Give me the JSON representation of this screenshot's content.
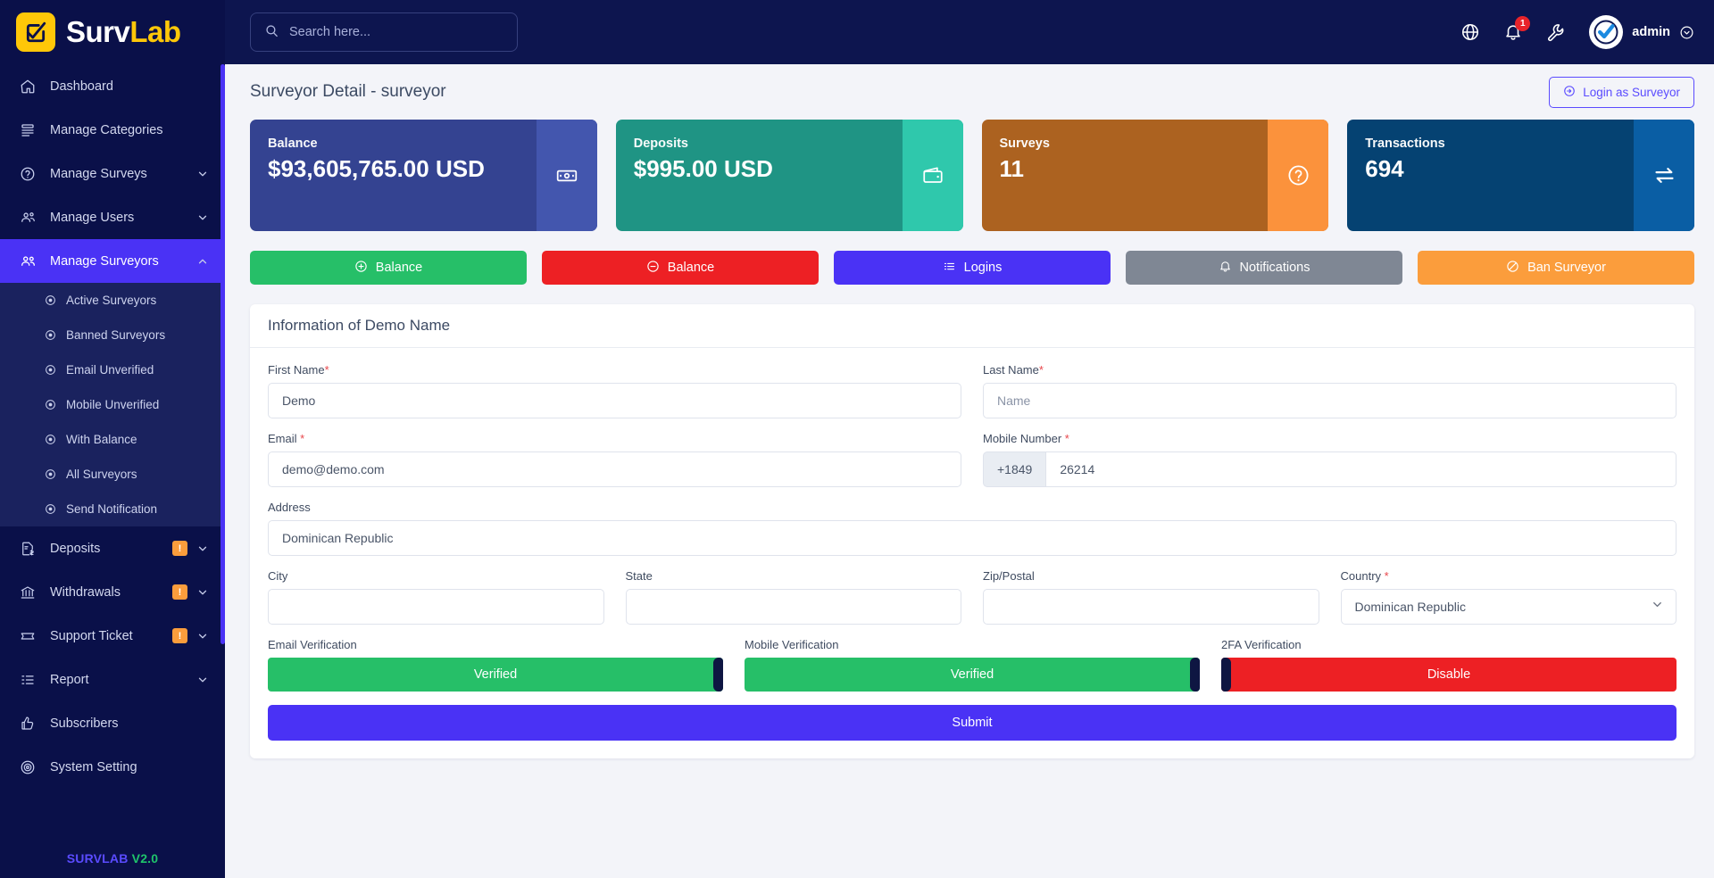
{
  "brand": {
    "word1": "Surv",
    "word2": "Lab",
    "logo_icon": "checkbox-check-icon"
  },
  "sidebar": {
    "items": [
      {
        "label": "Dashboard",
        "icon": "home-icon",
        "expandable": false,
        "badge": null
      },
      {
        "label": "Manage Categories",
        "icon": "layers-icon",
        "expandable": false,
        "badge": null
      },
      {
        "label": "Manage Surveys",
        "icon": "question-circle-icon",
        "expandable": true,
        "badge": null
      },
      {
        "label": "Manage Users",
        "icon": "users-icon",
        "expandable": true,
        "badge": null
      },
      {
        "label": "Manage Surveyors",
        "icon": "user-group-icon",
        "expandable": true,
        "badge": null,
        "active": true
      }
    ],
    "submenu": [
      {
        "label": "Active Surveyors",
        "icon": "dot-circle-icon"
      },
      {
        "label": "Banned Surveyors",
        "icon": "dot-circle-icon"
      },
      {
        "label": "Email Unverified",
        "icon": "dot-circle-icon"
      },
      {
        "label": "Mobile Unverified",
        "icon": "dot-circle-icon"
      },
      {
        "label": "With Balance",
        "icon": "dot-circle-icon"
      },
      {
        "label": "All Surveyors",
        "icon": "dot-circle-icon"
      },
      {
        "label": "Send Notification",
        "icon": "dot-circle-icon"
      }
    ],
    "items_bottom": [
      {
        "label": "Deposits",
        "icon": "document-dollar-icon",
        "expandable": true,
        "badge": "!"
      },
      {
        "label": "Withdrawals",
        "icon": "bank-icon",
        "expandable": true,
        "badge": "!"
      },
      {
        "label": "Support Ticket",
        "icon": "ticket-icon",
        "expandable": true,
        "badge": "!"
      },
      {
        "label": "Report",
        "icon": "list-icon",
        "expandable": true,
        "badge": null
      },
      {
        "label": "Subscribers",
        "icon": "thumbs-up-icon",
        "expandable": false,
        "badge": null
      },
      {
        "label": "System Setting",
        "icon": "gear-circle-icon",
        "expandable": false,
        "badge": null
      }
    ],
    "version_name": "SURVLAB",
    "version_number": "V2.0"
  },
  "topbar": {
    "search_placeholder": "Search here...",
    "search_value": "",
    "icons": [
      "globe-icon",
      "bell-icon",
      "wrench-icon"
    ],
    "notification_count": "1",
    "username": "admin"
  },
  "page": {
    "title": "Surveyor Detail - surveyor",
    "login_as_surveyor": "Login as Surveyor"
  },
  "cards": [
    {
      "label": "Balance",
      "value": "$93,605,765.00 USD",
      "icon": "money-bill-icon",
      "bg": "#344391",
      "icon_bg": "#4356ae"
    },
    {
      "label": "Deposits",
      "value": "$995.00 USD",
      "icon": "wallet-icon",
      "bg": "#1f9484",
      "icon_bg": "#2fc8ac"
    },
    {
      "label": "Surveys",
      "value": "11",
      "icon": "question-circle-icon",
      "bg": "#ac6220",
      "icon_bg": "#fb923c"
    },
    {
      "label": "Transactions",
      "value": "694",
      "icon": "exchange-icon",
      "bg": "#054272",
      "icon_bg": "#0a5ea4"
    }
  ],
  "actions": [
    {
      "label": "Balance",
      "icon": "plus-circle-icon",
      "color": "#26bf68"
    },
    {
      "label": "Balance",
      "icon": "minus-circle-icon",
      "color": "#ed2024"
    },
    {
      "label": "Logins",
      "icon": "list-ol-icon",
      "color": "#4a32f5"
    },
    {
      "label": "Notifications",
      "icon": "bell-icon",
      "color": "#7f8794"
    },
    {
      "label": "Ban Surveyor",
      "icon": "ban-icon",
      "color": "#fb9d3c"
    }
  ],
  "form": {
    "heading": "Information of Demo Name",
    "first_name": {
      "label": "First Name",
      "required": true,
      "value": "Demo",
      "placeholder": ""
    },
    "last_name": {
      "label": "Last Name",
      "required": true,
      "value": "",
      "placeholder": "Name"
    },
    "email": {
      "label": "Email",
      "required": true,
      "value": "demo@demo.com",
      "placeholder": ""
    },
    "mobile": {
      "label": "Mobile Number",
      "required": true,
      "prefix": "+1849",
      "value": "26214",
      "placeholder": ""
    },
    "address": {
      "label": "Address",
      "required": false,
      "value": "Dominican Republic",
      "placeholder": ""
    },
    "city": {
      "label": "City",
      "required": false,
      "value": "",
      "placeholder": ""
    },
    "state": {
      "label": "State",
      "required": false,
      "value": "",
      "placeholder": ""
    },
    "zip": {
      "label": "Zip/Postal",
      "required": false,
      "value": "",
      "placeholder": ""
    },
    "country": {
      "label": "Country",
      "required": true,
      "value": "Dominican Republic"
    },
    "email_verification": {
      "label": "Email Verification",
      "state": "Verified",
      "on": true
    },
    "mobile_verification": {
      "label": "Mobile Verification",
      "state": "Verified",
      "on": true
    },
    "twofa_verification": {
      "label": "2FA Verification",
      "state": "Disable",
      "on": false
    },
    "submit_label": "Submit"
  }
}
